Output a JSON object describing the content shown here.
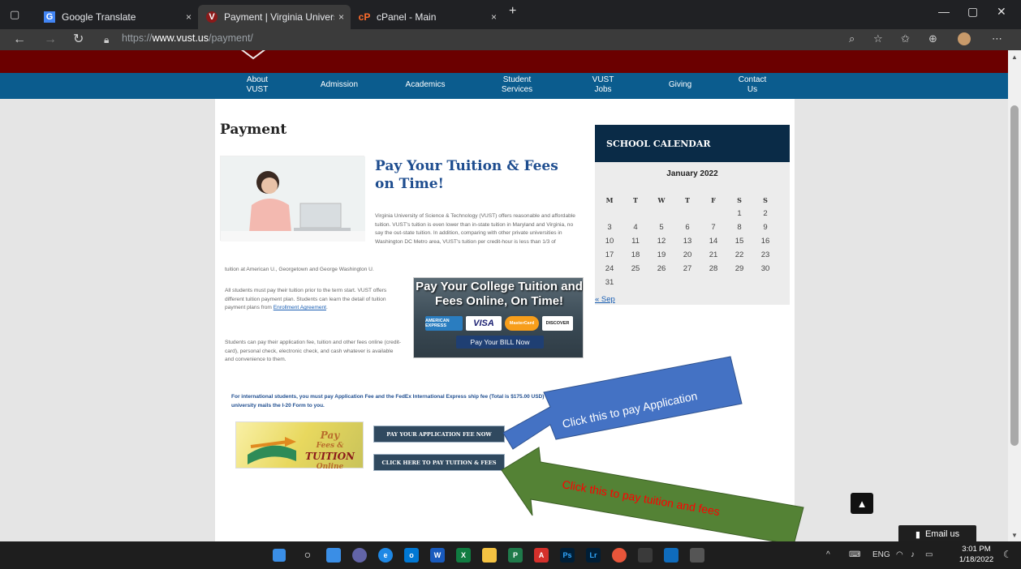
{
  "browser": {
    "tabs": [
      {
        "title": "Google Translate",
        "close": "×"
      },
      {
        "title": "Payment | Virginia University of S",
        "close": "×"
      },
      {
        "title": "cPanel - Main",
        "close": "×"
      }
    ],
    "new_tab": "+",
    "window_controls": {
      "minimize": "—",
      "maximize": "▢",
      "close": "✕"
    },
    "address": {
      "scheme": "https://",
      "host": "www.vust.us",
      "path": "/payment/"
    }
  },
  "site_nav": {
    "items": [
      {
        "line1": "About",
        "line2": "VUST"
      },
      {
        "line1": "Admission",
        "line2": ""
      },
      {
        "line1": "Academics",
        "line2": ""
      },
      {
        "line1": "Student",
        "line2": "Services"
      },
      {
        "line1": "VUST",
        "line2": "Jobs"
      },
      {
        "line1": "Giving",
        "line2": ""
      },
      {
        "line1": "Contact",
        "line2": "Us"
      }
    ]
  },
  "page": {
    "title": "Payment",
    "headline": "Pay Your Tuition & Fees on Time!",
    "para1": "Virginia University of Science & Technology (VUST) offers reasonable and affordable tuition. VUST's tuition is even lower than in-state tuition in Maryland and Virginia, no say the out-state tuition. In addition, comparing with other private universities in Washington DC Metro area, VUST's tuition per credit-hour is less than 1/3 of",
    "para1_cont": "tuition at  American U., Georgetown and George Washington U.",
    "para2_pre": "All students must pay their tuition prior to the term start.  VUST offers different tuition payment plan. Students can learn the detail of tuition payment plans from ",
    "para2_link": "Enrollment Agreement",
    "para2_post": ".",
    "para3": "Students can pay their application fee, tuition and other fees online (credit-card), personal check, electronic check, and cash whatever is available and convenience to them.",
    "banner": {
      "title": "Pay Your College Tuition and Fees Online, On Time!",
      "cards": [
        "AMERICAN EXPRESS",
        "VISA",
        "MasterCard",
        "DISCOVER"
      ],
      "button": "Pay Your BILL Now"
    },
    "intl_notice": "For international students, you must pay Application Fee and the FedEx International Express ship fee (Total is $175.00 USD) before university mails the I-20 Form to you.",
    "pay_image_text": {
      "line1": "Pay",
      "line2": "Fees &",
      "line3": "TUITION",
      "line4": "Online"
    },
    "btn_application": "PAY YOUR APPLICATION FEE NOW",
    "btn_tuition": "CLICK HERE TO PAY TUITION & FEES"
  },
  "calendar": {
    "heading": "SCHOOL CALENDAR",
    "month": "January 2022",
    "dows": [
      "M",
      "T",
      "W",
      "T",
      "F",
      "S",
      "S"
    ],
    "weeks": [
      [
        "",
        "",
        "",
        "",
        "",
        "1",
        "2"
      ],
      [
        "3",
        "4",
        "5",
        "6",
        "7",
        "8",
        "9"
      ],
      [
        "10",
        "11",
        "12",
        "13",
        "14",
        "15",
        "16"
      ],
      [
        "17",
        "18",
        "19",
        "20",
        "21",
        "22",
        "23"
      ],
      [
        "24",
        "25",
        "26",
        "27",
        "28",
        "29",
        "30"
      ],
      [
        "31",
        "",
        "",
        "",
        "",
        "",
        ""
      ]
    ],
    "prev": "« Sep"
  },
  "annotations": {
    "arrow_blue": {
      "text": "Click this to pay Application",
      "color": "#4472c4"
    },
    "arrow_green": {
      "text": "Click this to pay tuition and fees",
      "color": "#548235",
      "text_color": "#ff0000"
    }
  },
  "widgets": {
    "scroll_top": "▲",
    "email_us": "Email us"
  },
  "taskbar": {
    "tray": {
      "language": "ENG",
      "time": "3:01 PM",
      "date": "1/18/2022"
    }
  }
}
